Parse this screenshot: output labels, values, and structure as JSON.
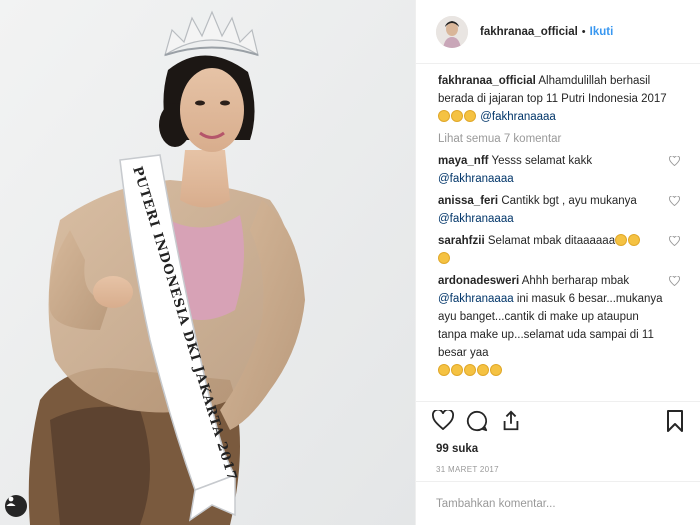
{
  "header": {
    "username": "fakhranaa_official",
    "separator": "•",
    "follow_label": "Ikuti"
  },
  "caption": {
    "username": "fakhranaa_official",
    "text": "Alhamdulillah berhasil berada di jajaran top 11 Putri Indonesia 2017",
    "emojis": [
      "clapping-hands",
      "clapping-hands",
      "clapping-hands"
    ],
    "mention": "@fakhranaaaa"
  },
  "view_all_comments": "Lihat semua 7 komentar",
  "comments": [
    {
      "username": "maya_nff",
      "text": "Yesss selamat kakk",
      "mention": "@fakhranaaaa",
      "emojis": []
    },
    {
      "username": "anissa_feri",
      "text": "Cantikk bgt , ayu mukanya",
      "mention": "@fakhranaaaa",
      "emojis": []
    },
    {
      "username": "sarahfzii",
      "text": "Selamat mbak ditaaaaaa",
      "mention": "",
      "emojis": [
        "grinning-face",
        "grinning-face",
        "grinning-face"
      ]
    },
    {
      "username": "ardonadesweri",
      "text": "Ahhh berharap mbak",
      "mention": "@fakhranaaaa",
      "text2": "ini masuk 6 besar...mukanya ayu banget...cantik di make up ataupun tanpa make up...selamat uda sampai di 11 besar yaa",
      "emojis": [
        "clapping-hands",
        "clapping-hands",
        "clapping-hands",
        "ok-hand",
        "thumbs-up"
      ]
    }
  ],
  "photo": {
    "sash_text": "PUTERI INDONESIA DKI JAKARTA 2017"
  },
  "likes": "99 suka",
  "date": "31 MARET 2017",
  "add_comment": {
    "placeholder": "Tambahkan komentar..."
  },
  "icons": [
    "user-tag-icon",
    "heart-icon",
    "comment-icon",
    "share-icon",
    "bookmark-icon",
    "small-heart-icon"
  ]
}
